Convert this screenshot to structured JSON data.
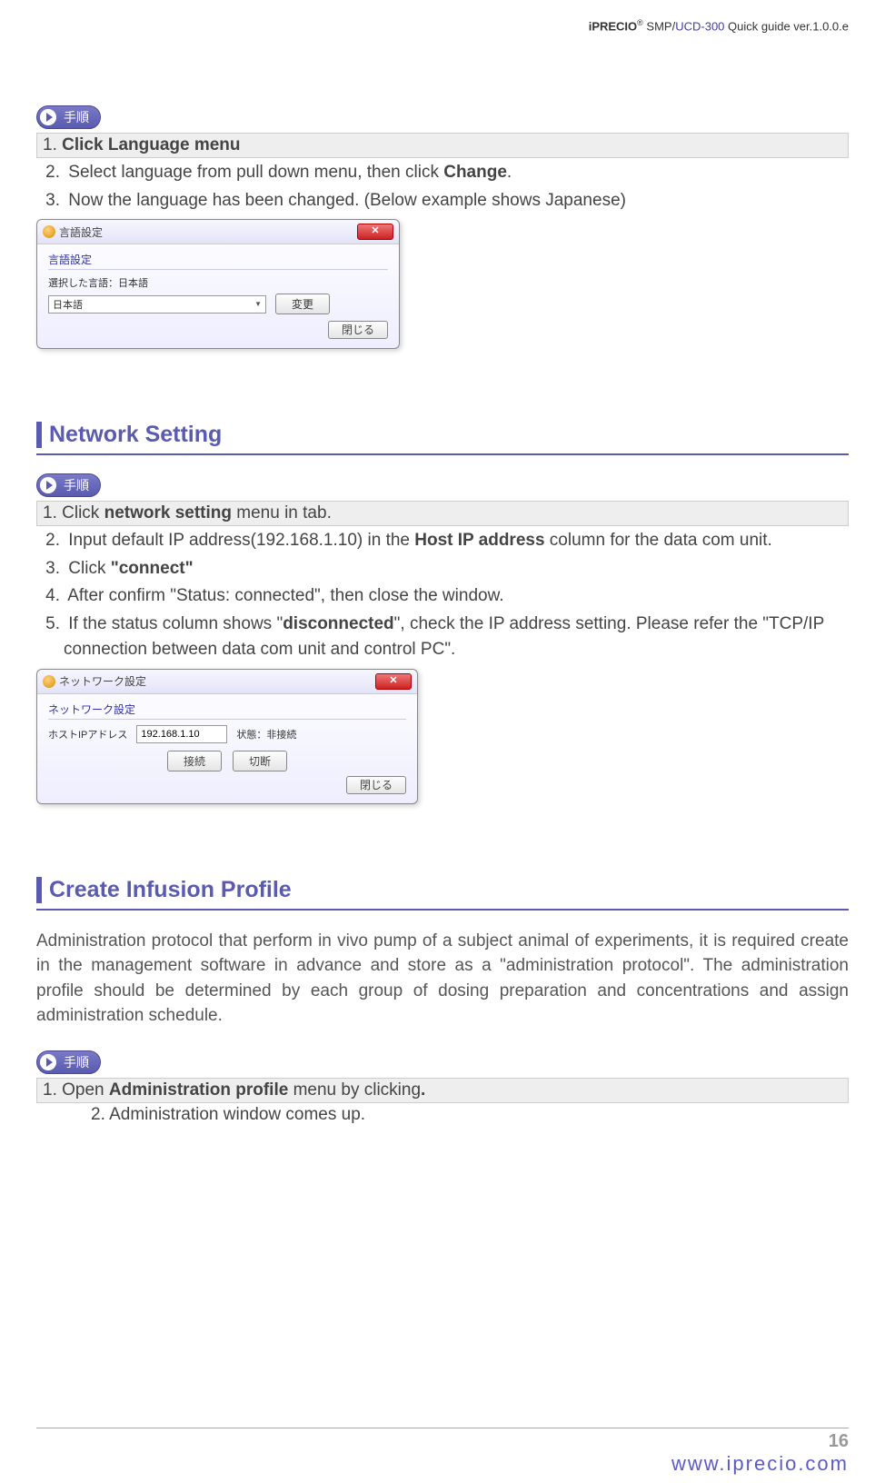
{
  "header": {
    "brand": "iPRECIO",
    "reg": "®",
    "model_prefix": " SMP/",
    "model_colored": "UCD-300",
    "suffix": " Quick guide ver.1.0.0.e"
  },
  "badge_label": "手順",
  "section1": {
    "step1_num": "1.",
    "step1_text": "Click Language menu",
    "step2_num": "2.",
    "step2_pre": "Select language from pull down menu, then click ",
    "step2_bold": "Change",
    "step2_post": ".",
    "step3_num": "3.",
    "step3_text": "Now the language has been changed. (Below example shows Japanese)"
  },
  "dialog1": {
    "title": "言語設定",
    "group": "言語設定",
    "label": "選択した言語：日本語",
    "select_value": "日本語",
    "change_btn": "変更",
    "close_btn": "閉じる",
    "x": "✕"
  },
  "section2": {
    "heading": "Network Setting",
    "step1_num": "1.",
    "step1_pre": "Click ",
    "step1_bold": "network setting",
    "step1_post": " menu in tab.",
    "step2_num": "2.",
    "step2_pre": "Input default IP address(192.168.1.10) in the ",
    "step2_bold": "Host IP address",
    "step2_post": " column for the data com unit.",
    "step3_num": "3.",
    "step3_pre": "Click ",
    "step3_bold": "\"connect\"",
    "step4_num": "4.",
    "step4_text": "After confirm \"Status: connected\", then close the window.",
    "step5_num": "5.",
    "step5_pre": "If the status column shows \"",
    "step5_bold": "disconnected",
    "step5_post": "\", check the IP address setting. Please refer the \"TCP/IP connection between data com unit and control PC\"."
  },
  "dialog2": {
    "title": "ネットワーク設定",
    "group": "ネットワーク設定",
    "host_label": "ホストIPアドレス",
    "ip_value": "192.168.1.10",
    "status_label": "状態：非接続",
    "connect_btn": "接続",
    "disconnect_btn": "切断",
    "close_btn": "閉じる",
    "x": "✕"
  },
  "section3": {
    "heading": "Create Infusion Profile",
    "paragraph": "Administration protocol that perform in vivo pump of a subject animal of experiments, it is required create in the management software in advance and store as a \"administration protocol\". The administration profile should be determined by each group of dosing preparation and concentrations and assign administration schedule.",
    "step1_num": "1.",
    "step1_pre": "Open ",
    "step1_bold": "Administration profile",
    "step1_post": " menu by clicking",
    "step1_end": ".",
    "step2_num": "2.",
    "step2_text": "Administration window comes up."
  },
  "footer": {
    "page": "16",
    "url": "www.iprecio.com"
  }
}
